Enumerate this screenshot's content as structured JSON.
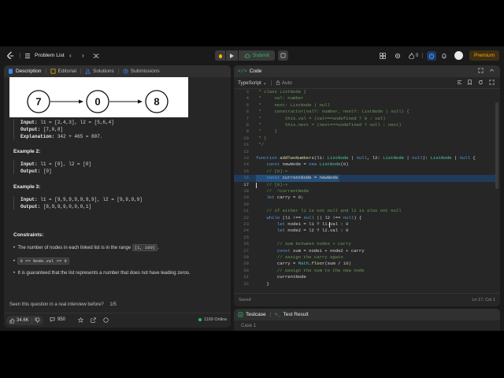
{
  "nav": {
    "problem_list": "Problem List",
    "submit": "Submit",
    "streak": "0",
    "premium": "Premium"
  },
  "desc_tabs": [
    {
      "label": "Description"
    },
    {
      "label": "Editorial"
    },
    {
      "label": "Solutions"
    },
    {
      "label": "Submissions"
    }
  ],
  "diagram": {
    "nodes": [
      "7",
      "0",
      "8"
    ]
  },
  "example1": {
    "input_label": "Input:",
    "input": "l1 = [2,4,3], l2 = [5,6,4]",
    "output_label": "Output:",
    "output": "[7,0,8]",
    "explanation_label": "Explanation:",
    "explanation": "342 + 465 = 807."
  },
  "example2": {
    "title": "Example 2:",
    "input_label": "Input:",
    "input": "l1 = [0], l2 = [0]",
    "output_label": "Output:",
    "output": "[0]"
  },
  "example3": {
    "title": "Example 3:",
    "input_label": "Input:",
    "input": "l1 = [9,9,9,9,9,9,9], l2 = [9,9,9,9]",
    "output_label": "Output:",
    "output": "[8,9,9,9,0,0,0,1]"
  },
  "constraints": {
    "title": "Constraints:",
    "c1_text": "The number of nodes in each linked list is in the range",
    "c1_code": "[1, 100]",
    "c1_end": ".",
    "c2_code": "0 <= Node.val <= 9",
    "c3_text": "It is guaranteed that the list represents a number that does not have leading zeros."
  },
  "interview": {
    "text": "Seen this question in a real interview before?",
    "count": "1/5"
  },
  "footer_left": {
    "likes": "34.6K",
    "comments": "950",
    "online": "1169 Online"
  },
  "code_panel": {
    "title": "Code",
    "language": "TypeScript",
    "auto": "Auto",
    "status_saved": "Saved",
    "cursor_pos": "Ln 17, Col 1",
    "lines": [
      {
        "n": "3",
        "t": " * class ListNode {"
      },
      {
        "n": "4",
        "t": " *     val: number"
      },
      {
        "n": "5",
        "t": " *     next: ListNode | null"
      },
      {
        "n": "6",
        "t": " *     constructor(val?: number, next?: ListNode | null) {"
      },
      {
        "n": "7",
        "t": " *         this.val = (val===undefined ? 0 : val)"
      },
      {
        "n": "8",
        "t": " *         this.next = (next===undefined ? null : next)"
      },
      {
        "n": "9",
        "t": " *     }"
      },
      {
        "n": "10",
        "t": " * }"
      },
      {
        "n": "11",
        "t": " */"
      },
      {
        "n": "12",
        "t": ""
      },
      {
        "n": "13",
        "t": "function addTwoNumbers(l1: ListNode | null, l2: ListNode | null): ListNode | null {"
      },
      {
        "n": "14",
        "t": "    const newNode = new ListNode(0)"
      },
      {
        "n": "15",
        "t": "    // [0]->"
      },
      {
        "n": "16",
        "t": "    const currentNode = newNode"
      },
      {
        "n": "17",
        "t": "    // [0]->"
      },
      {
        "n": "18",
        "t": "    //  ^currentNode"
      },
      {
        "n": "19",
        "t": "    let carry = 0;"
      },
      {
        "n": "20",
        "t": ""
      },
      {
        "n": "21",
        "t": "    // if either l1 is not null and l2 is also not null"
      },
      {
        "n": "22",
        "t": "    while (l1 !== null || l2 !== null) {"
      },
      {
        "n": "23",
        "t": "        let node1 = l1 ? l1.val : 0"
      },
      {
        "n": "24",
        "t": "        let node2 = l2 ? l2.val : 0"
      },
      {
        "n": "25",
        "t": ""
      },
      {
        "n": "26",
        "t": "        // sum between nodes + carry"
      },
      {
        "n": "27",
        "t": "        const sum = node1 + node2 + carry"
      },
      {
        "n": "28",
        "t": "        // assign the carry again"
      },
      {
        "n": "29",
        "t": "        carry = Math.floor(sum / 10)"
      },
      {
        "n": "30",
        "t": "        // assign the sum to the new node"
      },
      {
        "n": "31",
        "t": "        currentNode"
      },
      {
        "n": "32",
        "t": "    }"
      }
    ]
  },
  "bottom_tabs": [
    {
      "label": "Testcase"
    },
    {
      "label": "Test Result"
    }
  ],
  "bottom_content": "Case 1",
  "colors": {
    "accent_green": "#2cbb5d",
    "premium": "#ffa116",
    "selection": "#264f78",
    "keyword": "#569cd6",
    "comment": "#6a9955"
  }
}
